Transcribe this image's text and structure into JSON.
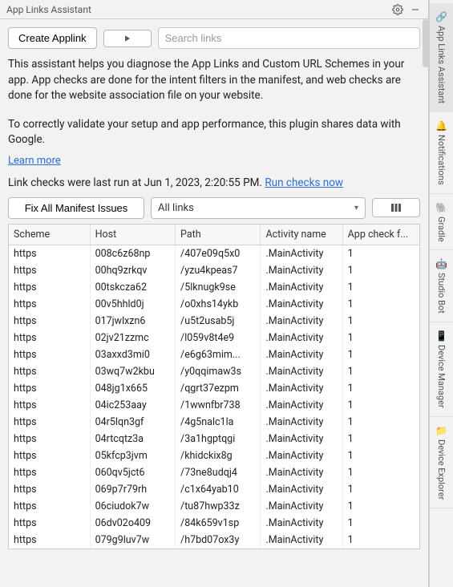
{
  "panel": {
    "title": "App Links Assistant"
  },
  "sidebar": {
    "tabs": [
      {
        "label": "App Links Assistant"
      },
      {
        "label": "Notifications"
      },
      {
        "label": "Gradle"
      },
      {
        "label": "Studio Bot"
      },
      {
        "label": "Device Manager"
      },
      {
        "label": "Device Explorer"
      }
    ]
  },
  "controls": {
    "create": "Create Applink",
    "search_placeholder": "Search links",
    "fix": "Fix All Manifest Issues",
    "filter": "All links"
  },
  "text": {
    "desc1": "This assistant helps you diagnose the App Links and Custom URL Schemes in your app. App checks are done for the intent filters in the manifest, and web checks are done for the website association file on your website.",
    "desc2": "To correctly validate your setup and app performance, this plugin shares data with Google.",
    "learn": "Learn more",
    "status": "Link checks were last run at Jun 1, 2023, 2:20:55 PM.  ",
    "run": "Run checks now"
  },
  "columns": {
    "scheme": "Scheme",
    "host": "Host",
    "path": "Path",
    "activity": "Activity name",
    "check": "App check f..."
  },
  "rows": [
    {
      "scheme": "https",
      "host": "008c6z68np",
      "path": "/407e09q5x0",
      "activity": ".MainActivity",
      "check": "1"
    },
    {
      "scheme": "https",
      "host": "00hq9zrkqv",
      "path": "/yzu4kpeas7",
      "activity": ".MainActivity",
      "check": "1"
    },
    {
      "scheme": "https",
      "host": "00tskcza62",
      "path": "/5lknugk9se",
      "activity": ".MainActivity",
      "check": "1"
    },
    {
      "scheme": "https",
      "host": "00v5hhld0j",
      "path": "/o0xhs14ykb",
      "activity": ".MainActivity",
      "check": "1"
    },
    {
      "scheme": "https",
      "host": "017jwlxzn6",
      "path": "/u5t2usab5j",
      "activity": ".MainActivity",
      "check": "1"
    },
    {
      "scheme": "https",
      "host": "02jv21zzmc",
      "path": "/l059v8t4e9",
      "activity": ".MainActivity",
      "check": "1"
    },
    {
      "scheme": "https",
      "host": "03axxd3mi0",
      "path": "/e6g63mim...",
      "activity": ".MainActivity",
      "check": "1"
    },
    {
      "scheme": "https",
      "host": "03wq7w2kbu",
      "path": "/y0qqimaw3s",
      "activity": ".MainActivity",
      "check": "1"
    },
    {
      "scheme": "https",
      "host": "048jg1x665",
      "path": "/qgrt37ezpm",
      "activity": ".MainActivity",
      "check": "1"
    },
    {
      "scheme": "https",
      "host": "04ic253aay",
      "path": "/1wwnfbr738",
      "activity": ".MainActivity",
      "check": "1"
    },
    {
      "scheme": "https",
      "host": "04r5lqn3gf",
      "path": "/4g5nalc1la",
      "activity": ".MainActivity",
      "check": "1"
    },
    {
      "scheme": "https",
      "host": "04rtcqtz3a",
      "path": "/3a1hgptqgi",
      "activity": ".MainActivity",
      "check": "1"
    },
    {
      "scheme": "https",
      "host": "05kfcp3jvm",
      "path": "/khidckix8g",
      "activity": ".MainActivity",
      "check": "1"
    },
    {
      "scheme": "https",
      "host": "060qv5jct6",
      "path": "/73ne8udqj4",
      "activity": ".MainActivity",
      "check": "1"
    },
    {
      "scheme": "https",
      "host": "069p7r79rh",
      "path": "/c1x64yab10",
      "activity": ".MainActivity",
      "check": "1"
    },
    {
      "scheme": "https",
      "host": "06ciudok7w",
      "path": "/tu87hwp33z",
      "activity": ".MainActivity",
      "check": "1"
    },
    {
      "scheme": "https",
      "host": "06dv02o409",
      "path": "/84k659v1sp",
      "activity": ".MainActivity",
      "check": "1"
    },
    {
      "scheme": "https",
      "host": "079g9luv7w",
      "path": "/h7bd07ox3y",
      "activity": ".MainActivity",
      "check": "1"
    }
  ]
}
